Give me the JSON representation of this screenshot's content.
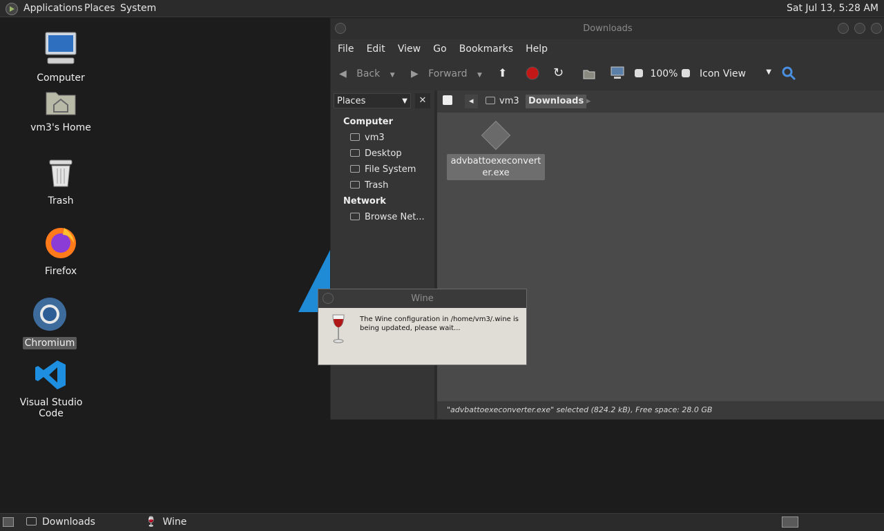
{
  "top_panel": {
    "menus": [
      "Applications",
      "Places",
      "System"
    ],
    "clock": "Sat Jul 13,  5:28 AM"
  },
  "desktop_icons": [
    {
      "label": "Computer"
    },
    {
      "label": "vm3's Home"
    },
    {
      "label": "Trash"
    },
    {
      "label": "Firefox"
    },
    {
      "label": "Chromium",
      "selected": true
    },
    {
      "label": "Visual Studio Code"
    }
  ],
  "file_manager": {
    "title": "Downloads",
    "menu": [
      "File",
      "Edit",
      "View",
      "Go",
      "Bookmarks",
      "Help"
    ],
    "toolbar": {
      "back": "Back",
      "forward": "Forward",
      "zoom": "100%",
      "view_mode": "Icon View"
    },
    "sidebar": {
      "header": "Places",
      "close": "✕",
      "sections": [
        {
          "title": "Computer",
          "items": [
            "vm3",
            "Desktop",
            "File System",
            "Trash"
          ]
        },
        {
          "title": "Network",
          "items": [
            "Browse Net..."
          ]
        }
      ]
    },
    "pathbar": [
      "vm3",
      "Downloads"
    ],
    "file": {
      "name": "advbattoexeconverter.exe"
    },
    "status": "\"advbattoexeconverter.exe\" selected (824.2 kB), Free space: 28.0 GB"
  },
  "wine_dialog": {
    "title": "Wine",
    "message": "The Wine configuration in /home/vm3/.wine is being updated, please wait..."
  },
  "taskbar": {
    "items": [
      "Downloads",
      "Wine"
    ]
  },
  "colors": {
    "accent_blue": "#1f8ad6",
    "wine_red": "#b01818"
  }
}
